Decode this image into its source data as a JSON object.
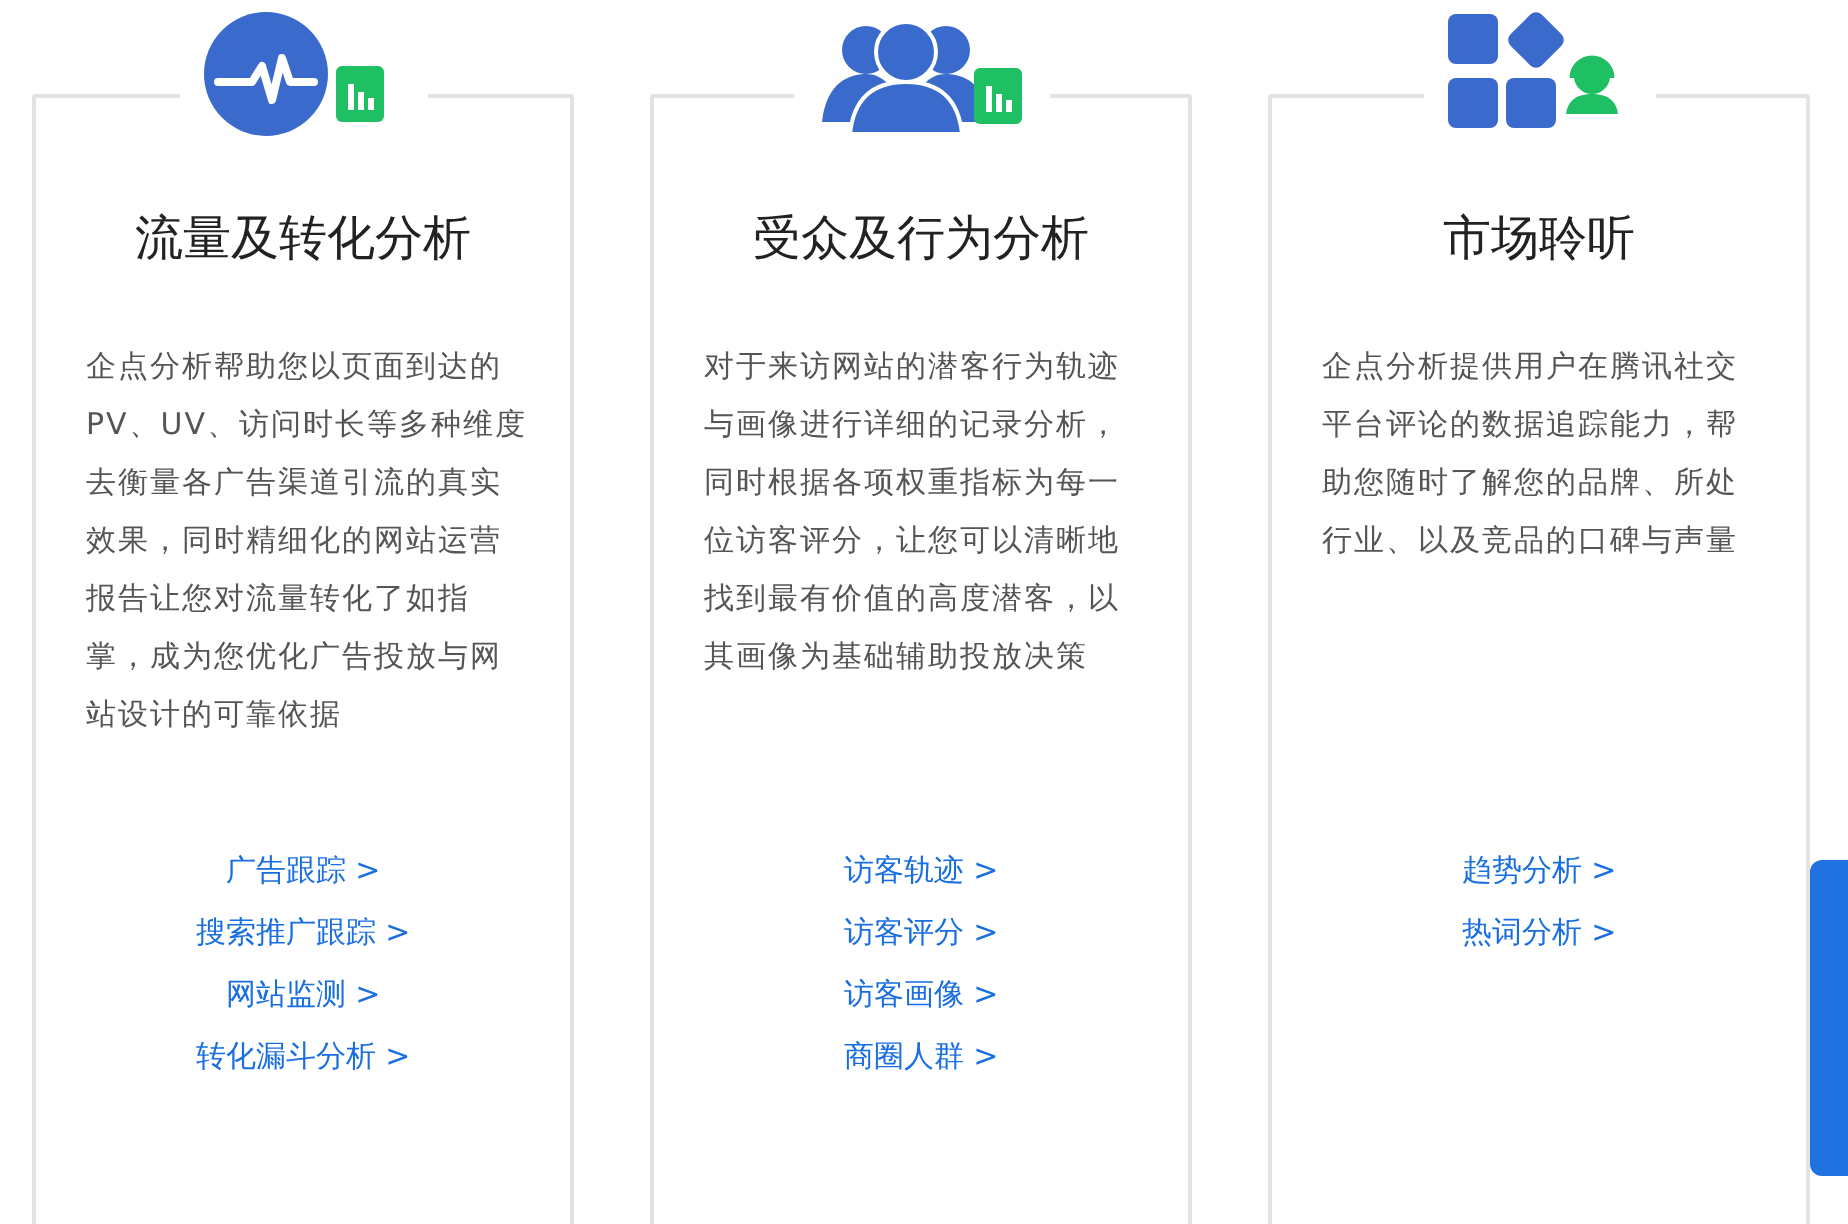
{
  "cards": [
    {
      "title": "流量及转化分析",
      "description": "企点分析帮助您以页面到达的PV、UV、访问时长等多种维度去衡量各广告渠道引流的真实效果，同时精细化的网站运营报告让您对流量转化了如指掌，成为您优化广告投放与网站设计的可靠依据",
      "links": [
        {
          "label": "广告跟踪",
          "arrow": ">"
        },
        {
          "label": "搜索推广跟踪",
          "arrow": ">"
        },
        {
          "label": "网站监测",
          "arrow": ">"
        },
        {
          "label": "转化漏斗分析",
          "arrow": ">"
        }
      ]
    },
    {
      "title": "受众及行为分析",
      "description": "对于来访网站的潜客行为轨迹与画像进行详细的记录分析，同时根据各项权重指标为每一位访客评分，让您可以清晰地找到最有价值的高度潜客，以其画像为基础辅助投放决策",
      "links": [
        {
          "label": "访客轨迹",
          "arrow": ">"
        },
        {
          "label": "访客评分",
          "arrow": ">"
        },
        {
          "label": "访客画像",
          "arrow": ">"
        },
        {
          "label": "商圈人群",
          "arrow": ">"
        }
      ]
    },
    {
      "title": "市场聆听",
      "description": "企点分析提供用户在腾讯社交平台评论的数据追踪能力，帮助您随时了解您的品牌、所处行业、以及竞品的口碑与声量",
      "links": [
        {
          "label": "趋势分析",
          "arrow": ">"
        },
        {
          "label": "热词分析",
          "arrow": ">"
        }
      ]
    }
  ]
}
